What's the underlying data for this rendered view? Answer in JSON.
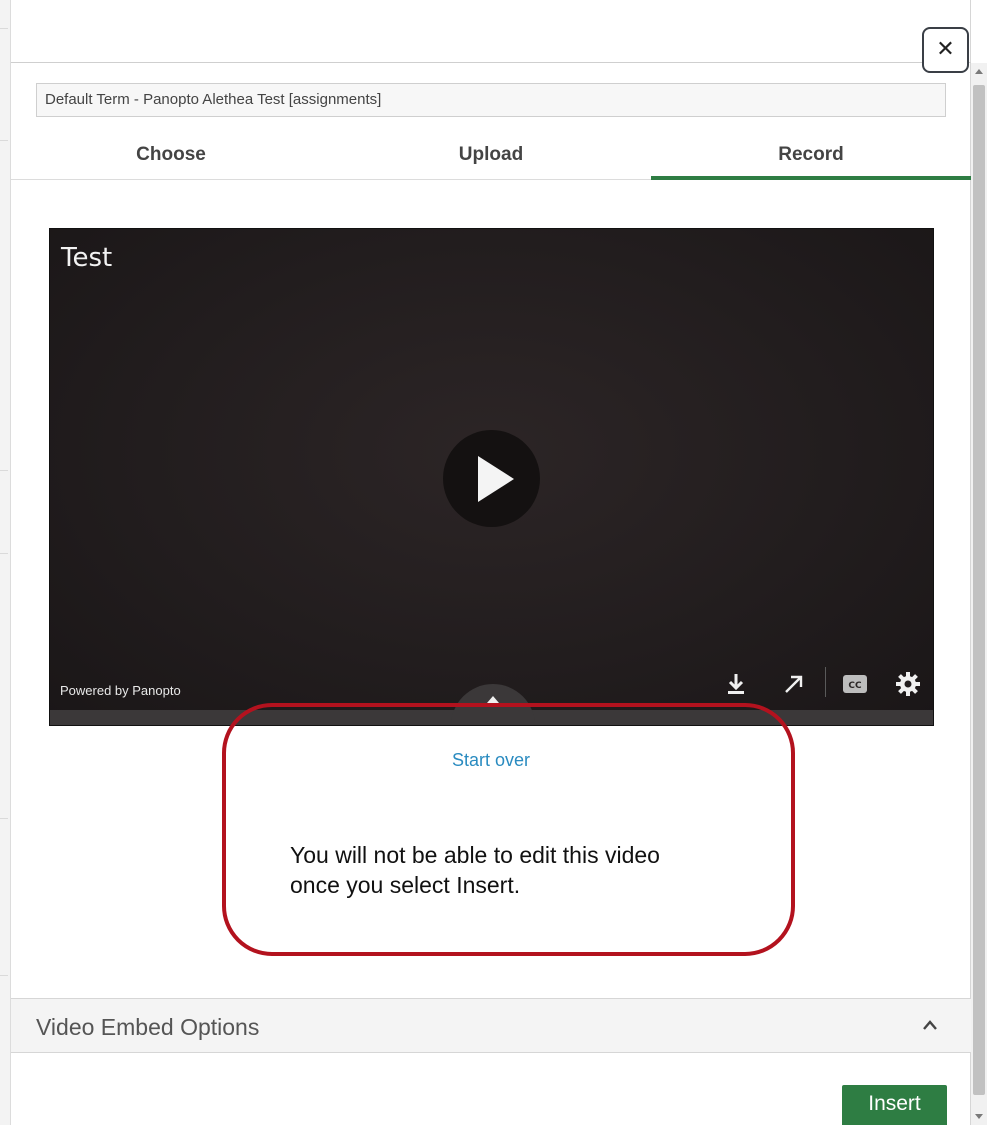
{
  "dialog": {
    "close_glyph": "✕",
    "folder_value": "Default Term - Panopto Alethea Test [assignments]",
    "tabs": [
      {
        "label": "Choose"
      },
      {
        "label": "Upload"
      },
      {
        "label": "Record"
      }
    ],
    "active_tab": "Record",
    "accent_color": "#2e7d43"
  },
  "player": {
    "title": "Test",
    "powered_by": "Powered by Panopto",
    "controls": [
      "download-icon",
      "open-external-icon",
      "closed-captions-icon",
      "settings-gear-icon"
    ]
  },
  "actions": {
    "start_over": "Start over",
    "insert": "Insert"
  },
  "callout": {
    "line1": "You will not be able to edit this video",
    "line2": "once you select Insert.",
    "border_color": "#b3121e"
  },
  "embed_options": {
    "title": "Video Embed Options"
  }
}
